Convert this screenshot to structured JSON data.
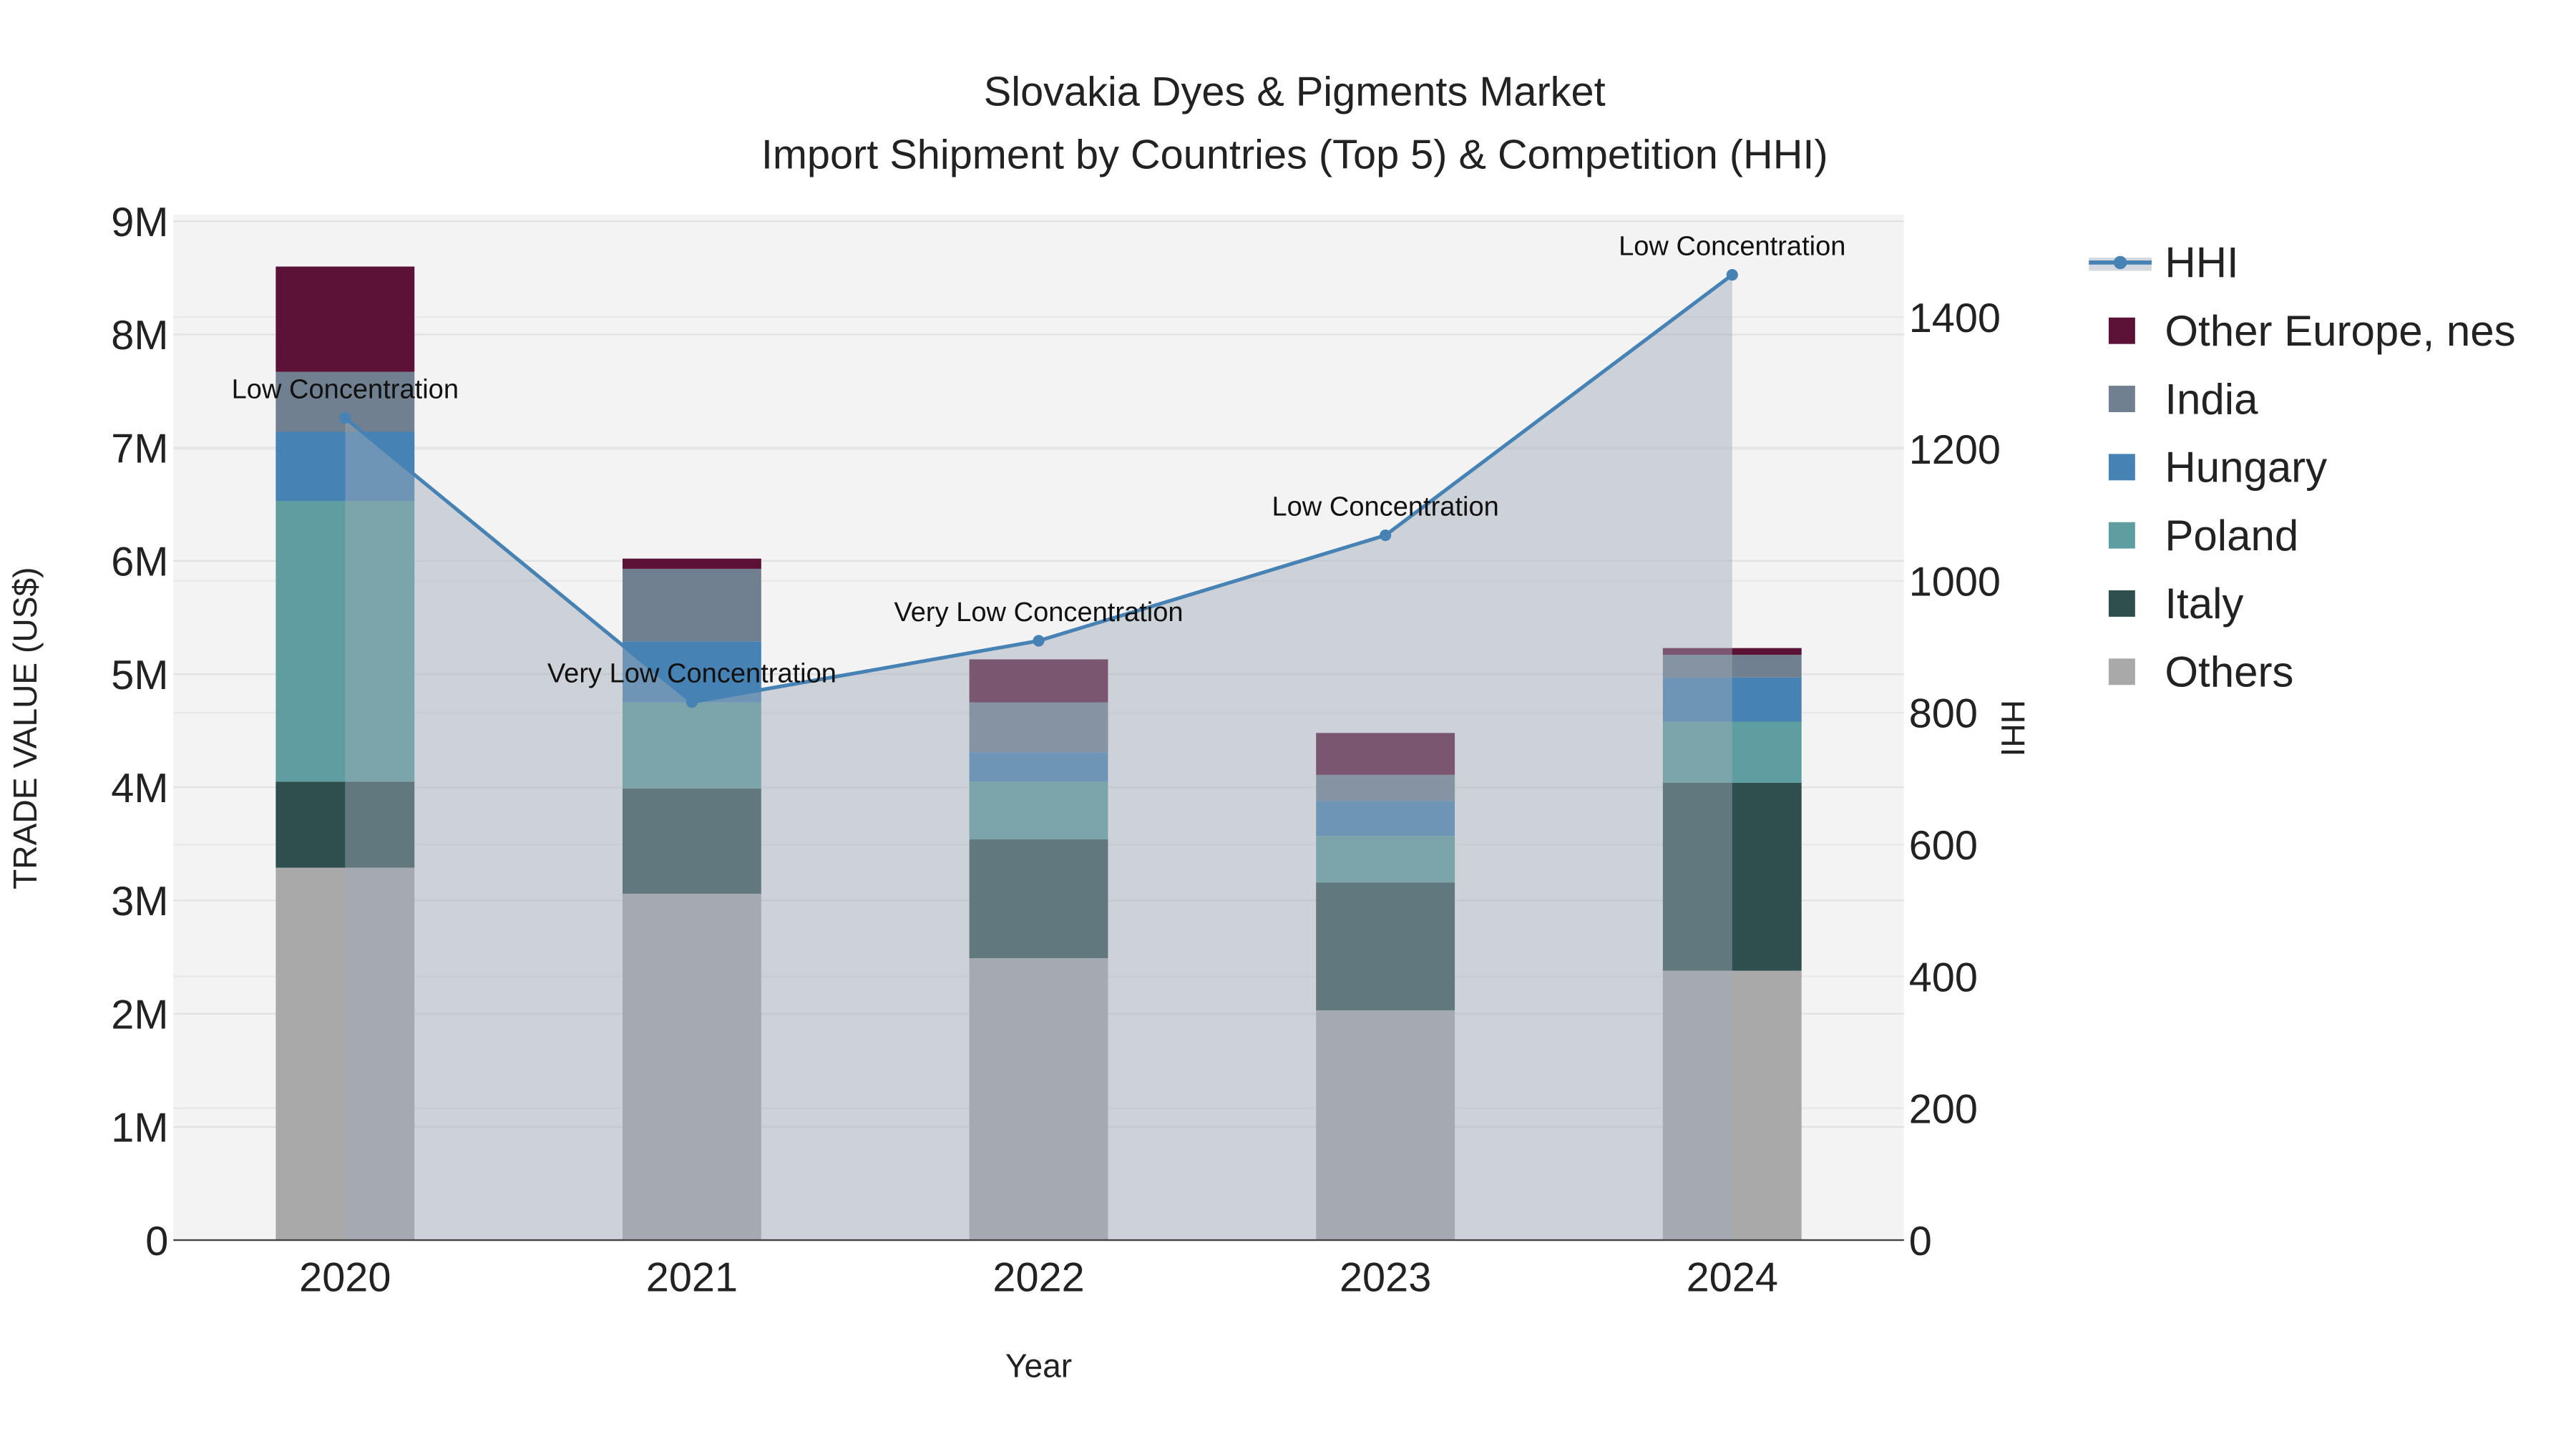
{
  "chart_data": {
    "type": "bar",
    "title_line1": "Slovakia Dyes & Pigments Market",
    "title_line2": "Import Shipment by Countries (Top 5) & Competition (HHI)",
    "xlabel": "Year",
    "ylabel": "TRADE VALUE (US$)",
    "y2label": "HHI",
    "categories": [
      "2020",
      "2021",
      "2022",
      "2023",
      "2024"
    ],
    "ylim": [
      0,
      9000000
    ],
    "yticks": [
      0,
      1000000,
      2000000,
      3000000,
      4000000,
      5000000,
      6000000,
      7000000,
      8000000,
      9000000
    ],
    "ytick_labels": [
      "0",
      "1M",
      "2M",
      "3M",
      "4M",
      "5M",
      "6M",
      "7M",
      "8M",
      "9M"
    ],
    "y2lim": [
      0,
      1550
    ],
    "y2ticks": [
      0,
      200,
      400,
      600,
      800,
      1000,
      1200,
      1400
    ],
    "y2tick_labels": [
      "0",
      "200",
      "400",
      "600",
      "800",
      "1000",
      "1200",
      "1400"
    ],
    "barmode": "stack",
    "series": [
      {
        "name": "Others",
        "color": "#a9a9a9",
        "values": [
          3290000,
          3060000,
          2490000,
          2030000,
          2380000
        ]
      },
      {
        "name": "Italy",
        "color": "#2f4f4f",
        "values": [
          760000,
          930000,
          1050000,
          1130000,
          1660000
        ]
      },
      {
        "name": "Poland",
        "color": "#5f9ea0",
        "values": [
          2480000,
          760000,
          510000,
          410000,
          540000
        ]
      },
      {
        "name": "Hungary",
        "color": "#4682b4",
        "values": [
          610000,
          540000,
          260000,
          310000,
          390000
        ]
      },
      {
        "name": "India",
        "color": "#708090",
        "values": [
          530000,
          640000,
          440000,
          230000,
          200000
        ]
      },
      {
        "name": "Other Europe, nes",
        "color": "#5c1237",
        "values": [
          930000,
          90000,
          380000,
          370000,
          60000
        ]
      }
    ],
    "line": {
      "name": "HHI",
      "color": "#4682b4",
      "values": [
        1247,
        816,
        909,
        1069,
        1464
      ],
      "annotations": [
        "Low Concentration",
        "Very Low Concentration",
        "Very Low Concentration",
        "Low Concentration",
        "Low Concentration"
      ]
    },
    "legend": [
      "HHI",
      "Other Europe, nes",
      "India",
      "Hungary",
      "Poland",
      "Italy",
      "Others"
    ],
    "legend_placement": "right",
    "grid": true
  }
}
